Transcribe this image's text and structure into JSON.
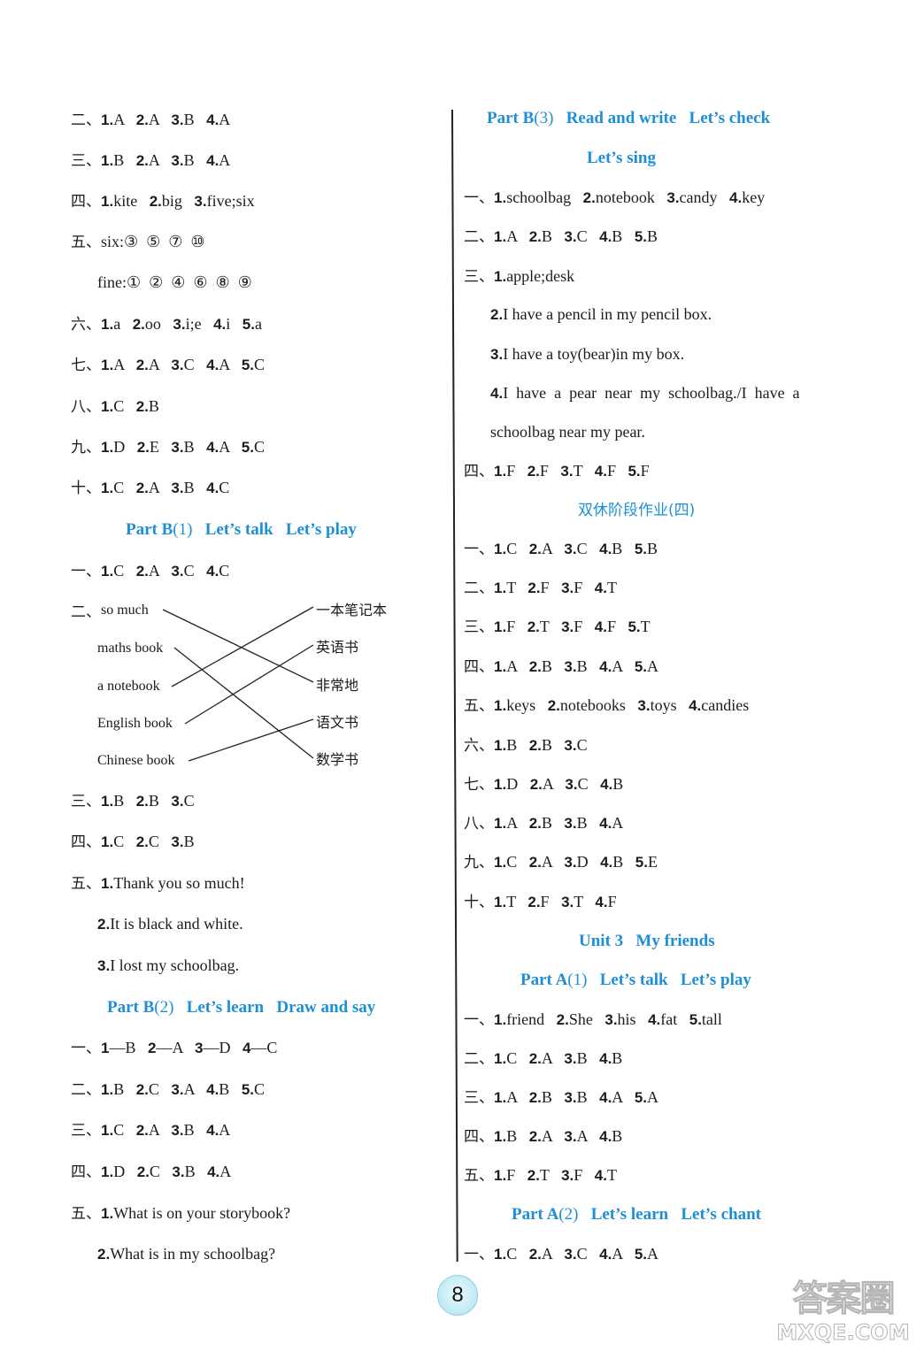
{
  "left_column": {
    "rows": [
      {
        "label": "二、",
        "items": [
          [
            "1.",
            "A"
          ],
          [
            "2.",
            "A"
          ],
          [
            "3.",
            "B"
          ],
          [
            "4.",
            "A"
          ]
        ]
      },
      {
        "label": "三、",
        "items": [
          [
            "1.",
            "B"
          ],
          [
            "2.",
            "A"
          ],
          [
            "3.",
            "B"
          ],
          [
            "4.",
            "A"
          ]
        ]
      },
      {
        "label": "四、",
        "items": [
          [
            "1.",
            "kite"
          ],
          [
            "2.",
            "big"
          ],
          [
            "3.",
            "five;six"
          ]
        ]
      },
      {
        "label": "五、",
        "items": [
          [
            "",
            "six:③  ⑤  ⑦  ⑩"
          ]
        ]
      },
      {
        "label": "",
        "items": [
          [
            "",
            "fine:①  ②  ④  ⑥  ⑧  ⑨"
          ]
        ]
      },
      {
        "label": "六、",
        "items": [
          [
            "1.",
            "a"
          ],
          [
            "2.",
            "oo"
          ],
          [
            "3.",
            "i;e"
          ],
          [
            "4.",
            "i"
          ],
          [
            "5.",
            "a"
          ]
        ]
      },
      {
        "label": "七、",
        "items": [
          [
            "1.",
            "A"
          ],
          [
            "2.",
            "A"
          ],
          [
            "3.",
            "C"
          ],
          [
            "4.",
            "A"
          ],
          [
            "5.",
            "C"
          ]
        ]
      },
      {
        "label": "八、",
        "items": [
          [
            "1.",
            "C"
          ],
          [
            "2.",
            "B"
          ]
        ]
      },
      {
        "label": "九、",
        "items": [
          [
            "1.",
            "D"
          ],
          [
            "2.",
            "E"
          ],
          [
            "3.",
            "B"
          ],
          [
            "4.",
            "A"
          ],
          [
            "5.",
            "C"
          ]
        ]
      },
      {
        "label": "十、",
        "items": [
          [
            "1.",
            "C"
          ],
          [
            "2.",
            "A"
          ],
          [
            "3.",
            "B"
          ],
          [
            "4.",
            "C"
          ]
        ]
      }
    ],
    "section_b1": {
      "part": "Part B",
      "num": "(1)",
      "title1": "Let’s talk",
      "title2": "Let’s play"
    },
    "b1_row1": {
      "label": "一、",
      "items": [
        [
          "1.",
          "C"
        ],
        [
          "2.",
          "A"
        ],
        [
          "3.",
          "C"
        ],
        [
          "4.",
          "C"
        ]
      ]
    },
    "matching": {
      "label": "二、",
      "left": [
        "so much",
        "maths book",
        "a notebook",
        "English book",
        "Chinese book"
      ],
      "right": [
        "一本笔记本",
        "英语书",
        "非常地",
        "语文书",
        "数学书"
      ],
      "pairs": [
        [
          0,
          2
        ],
        [
          1,
          4
        ],
        [
          2,
          0
        ],
        [
          3,
          1
        ],
        [
          4,
          3
        ]
      ]
    },
    "b1_rows": [
      {
        "label": "三、",
        "items": [
          [
            "1.",
            "B"
          ],
          [
            "2.",
            "B"
          ],
          [
            "3.",
            "C"
          ]
        ]
      },
      {
        "label": "四、",
        "items": [
          [
            "1.",
            "C"
          ],
          [
            "2.",
            "C"
          ],
          [
            "3.",
            "B"
          ]
        ]
      },
      {
        "label": "五、",
        "items": [
          [
            "1.",
            "Thank you so much!"
          ]
        ]
      },
      {
        "label": "",
        "items": [
          [
            "2.",
            "It is black and white."
          ]
        ]
      },
      {
        "label": "",
        "items": [
          [
            "3.",
            "I lost my schoolbag."
          ]
        ]
      }
    ],
    "section_b2": {
      "part": "Part B",
      "num": "(2)",
      "title1": "Let’s learn",
      "title2": "Draw and say"
    },
    "b2_rows": [
      {
        "label": "一、",
        "items": [
          [
            "1",
            "—B"
          ],
          [
            "2",
            "—A"
          ],
          [
            "3",
            "—D"
          ],
          [
            "4",
            "—C"
          ]
        ]
      },
      {
        "label": "二、",
        "items": [
          [
            "1.",
            "B"
          ],
          [
            "2.",
            "C"
          ],
          [
            "3.",
            "A"
          ],
          [
            "4.",
            "B"
          ],
          [
            "5.",
            "C"
          ]
        ]
      },
      {
        "label": "三、",
        "items": [
          [
            "1.",
            "C"
          ],
          [
            "2.",
            "A"
          ],
          [
            "3.",
            "B"
          ],
          [
            "4.",
            "A"
          ]
        ]
      },
      {
        "label": "四、",
        "items": [
          [
            "1.",
            "D"
          ],
          [
            "2.",
            "C"
          ],
          [
            "3.",
            "B"
          ],
          [
            "4.",
            "A"
          ]
        ]
      },
      {
        "label": "五、",
        "items": [
          [
            "1.",
            "What is on your storybook?"
          ]
        ]
      },
      {
        "label": "",
        "items": [
          [
            "2.",
            "What is in my schoolbag?"
          ]
        ]
      }
    ]
  },
  "right_column": {
    "section_b3": {
      "part": "Part B",
      "num": "(3)",
      "title1": "Read and write",
      "title2": "Let’s check",
      "title3": "Let’s sing"
    },
    "b3_rows": [
      {
        "label": "一、",
        "items": [
          [
            "1.",
            "schoolbag"
          ],
          [
            "2.",
            "notebook"
          ],
          [
            "3.",
            "candy"
          ],
          [
            "4.",
            "key"
          ]
        ]
      },
      {
        "label": "二、",
        "items": [
          [
            "1.",
            "A"
          ],
          [
            "2.",
            "B"
          ],
          [
            "3.",
            "C"
          ],
          [
            "4.",
            "B"
          ],
          [
            "5.",
            "B"
          ]
        ]
      },
      {
        "label": "三、",
        "items": [
          [
            "1.",
            "apple;desk"
          ]
        ]
      },
      {
        "label": "",
        "items": [
          [
            "2.",
            "I have a pencil in my pencil box."
          ]
        ]
      },
      {
        "label": "",
        "items": [
          [
            "3.",
            "I have a toy(bear)in my box."
          ]
        ]
      },
      {
        "label": "",
        "items": [
          [
            "4.",
            "I  have  a  pear  near  my  schoolbag./I  have  a"
          ]
        ]
      },
      {
        "label": "",
        "items": [
          [
            "",
            "schoolbag near my pear."
          ]
        ]
      },
      {
        "label": "四、",
        "items": [
          [
            "1.",
            "F"
          ],
          [
            "2.",
            "F"
          ],
          [
            "3.",
            "T"
          ],
          [
            "4.",
            "F"
          ],
          [
            "5.",
            "F"
          ]
        ]
      }
    ],
    "section_weekend": {
      "title": "双休阶段作业(四)"
    },
    "weekend_rows": [
      {
        "label": "一、",
        "items": [
          [
            "1.",
            "C"
          ],
          [
            "2.",
            "A"
          ],
          [
            "3.",
            "C"
          ],
          [
            "4.",
            "B"
          ],
          [
            "5.",
            "B"
          ]
        ]
      },
      {
        "label": "二、",
        "items": [
          [
            "1.",
            "T"
          ],
          [
            "2.",
            "F"
          ],
          [
            "3.",
            "F"
          ],
          [
            "4.",
            "T"
          ]
        ]
      },
      {
        "label": "三、",
        "items": [
          [
            "1.",
            "F"
          ],
          [
            "2.",
            "T"
          ],
          [
            "3.",
            "F"
          ],
          [
            "4.",
            "F"
          ],
          [
            "5.",
            "T"
          ]
        ]
      },
      {
        "label": "四、",
        "items": [
          [
            "1.",
            "A"
          ],
          [
            "2.",
            "B"
          ],
          [
            "3.",
            "B"
          ],
          [
            "4.",
            "A"
          ],
          [
            "5.",
            "A"
          ]
        ]
      },
      {
        "label": "五、",
        "items": [
          [
            "1.",
            "keys"
          ],
          [
            "2.",
            "notebooks"
          ],
          [
            "3.",
            "toys"
          ],
          [
            "4.",
            "candies"
          ]
        ]
      },
      {
        "label": "六、",
        "items": [
          [
            "1.",
            "B"
          ],
          [
            "2.",
            "B"
          ],
          [
            "3.",
            "C"
          ]
        ]
      },
      {
        "label": "七、",
        "items": [
          [
            "1.",
            "D"
          ],
          [
            "2.",
            "A"
          ],
          [
            "3.",
            "C"
          ],
          [
            "4.",
            "B"
          ]
        ]
      },
      {
        "label": "八、",
        "items": [
          [
            "1.",
            "A"
          ],
          [
            "2.",
            "B"
          ],
          [
            "3.",
            "B"
          ],
          [
            "4.",
            "A"
          ]
        ]
      },
      {
        "label": "九、",
        "items": [
          [
            "1.",
            "C"
          ],
          [
            "2.",
            "A"
          ],
          [
            "3.",
            "D"
          ],
          [
            "4.",
            "B"
          ],
          [
            "5.",
            "E"
          ]
        ]
      },
      {
        "label": "十、",
        "items": [
          [
            "1.",
            "T"
          ],
          [
            "2.",
            "F"
          ],
          [
            "3.",
            "T"
          ],
          [
            "4.",
            "F"
          ]
        ]
      }
    ],
    "section_unit3": {
      "unit": "Unit 3",
      "title": "My friends"
    },
    "section_a1": {
      "part": "Part A",
      "num": "(1)",
      "title1": "Let’s talk",
      "title2": "Let’s play"
    },
    "a1_rows": [
      {
        "label": "一、",
        "items": [
          [
            "1.",
            "friend"
          ],
          [
            "2.",
            "She"
          ],
          [
            "3.",
            "his"
          ],
          [
            "4.",
            "fat"
          ],
          [
            "5.",
            "tall"
          ]
        ]
      },
      {
        "label": "二、",
        "items": [
          [
            "1.",
            "C"
          ],
          [
            "2.",
            "A"
          ],
          [
            "3.",
            "B"
          ],
          [
            "4.",
            "B"
          ]
        ]
      },
      {
        "label": "三、",
        "items": [
          [
            "1.",
            "A"
          ],
          [
            "2.",
            "B"
          ],
          [
            "3.",
            "B"
          ],
          [
            "4.",
            "A"
          ],
          [
            "5.",
            "A"
          ]
        ]
      },
      {
        "label": "四、",
        "items": [
          [
            "1.",
            "B"
          ],
          [
            "2.",
            "A"
          ],
          [
            "3.",
            "A"
          ],
          [
            "4.",
            "B"
          ]
        ]
      },
      {
        "label": "五、",
        "items": [
          [
            "1.",
            "F"
          ],
          [
            "2.",
            "T"
          ],
          [
            "3.",
            "F"
          ],
          [
            "4.",
            "T"
          ]
        ]
      }
    ],
    "section_a2": {
      "part": "Part A",
      "num": "(2)",
      "title1": "Let’s learn",
      "title2": "Let’s chant"
    },
    "a2_rows": [
      {
        "label": "一、",
        "items": [
          [
            "1.",
            "C"
          ],
          [
            "2.",
            "A"
          ],
          [
            "3.",
            "C"
          ],
          [
            "4.",
            "A"
          ],
          [
            "5.",
            "A"
          ]
        ]
      }
    ]
  },
  "footer": {
    "page_number": "8",
    "watermark_top": "答案圈",
    "watermark_bottom": "MXQE.COM"
  },
  "colors": {
    "heading_blue": "#1e8fd6",
    "text": "#1c1c1c",
    "page_badge": "#bfeaf5"
  }
}
